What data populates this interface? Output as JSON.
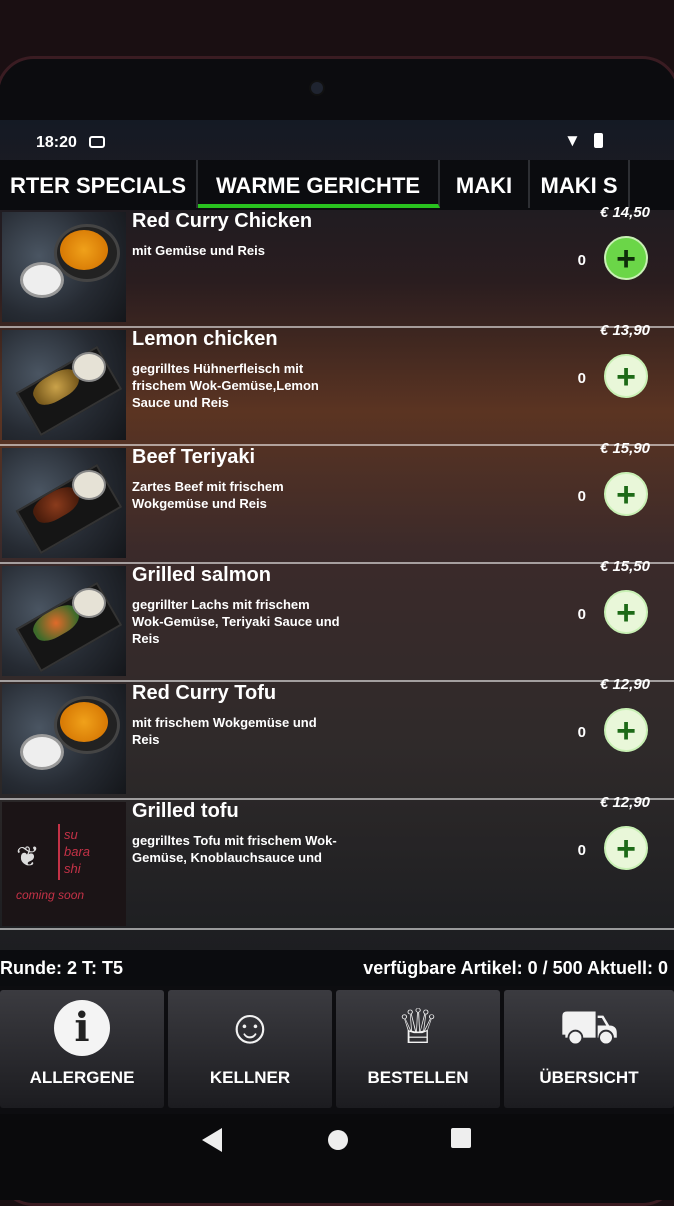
{
  "status": {
    "time": "18:20"
  },
  "tabs": [
    {
      "label": "RTER SPECIALS",
      "active": false
    },
    {
      "label": "WARME GERICHTE",
      "active": true
    },
    {
      "label": "MAKI",
      "active": false
    },
    {
      "label": "MAKI S",
      "active": false
    }
  ],
  "items": [
    {
      "name": "Red Curry Chicken",
      "desc": "mit Gemüse und Reis",
      "price": "€ 14,50",
      "qty": "0"
    },
    {
      "name": "Lemon chicken",
      "desc": "gegrilltes Hühnerfleisch mit frischem Wok-Gemüse,Lemon Sauce und Reis",
      "price": "€ 13,90",
      "qty": "0"
    },
    {
      "name": "Beef Teriyaki",
      "desc": "Zartes Beef mit frischem Wokgemüse und Reis",
      "price": "€ 15,90",
      "qty": "0"
    },
    {
      "name": "Grilled salmon",
      "desc": "gegrillter Lachs mit frischem Wok-Gemüse, Teriyaki Sauce und Reis",
      "price": "€ 15,50",
      "qty": "0"
    },
    {
      "name": "Red Curry Tofu",
      "desc": "mit frischem Wokgemüse und Reis",
      "price": "€ 12,90",
      "qty": "0"
    },
    {
      "name": "Grilled tofu",
      "desc": "gegrilltes Tofu mit frischem Wok-Gemüse, Knoblauchsauce und",
      "price": "€ 12,90",
      "qty": "0"
    }
  ],
  "logo": {
    "line1": "su",
    "line2": "bara",
    "line3": "shi",
    "sub": "coming soon"
  },
  "add_symbol": "+",
  "info_bar": {
    "round": "Runde: 2 T: T5",
    "available": "verfügbare Artikel: 0 / 500 Aktuell: 0"
  },
  "nav": [
    {
      "label": "ALLERGENE",
      "icon": "info-icon"
    },
    {
      "label": "KELLNER",
      "icon": "waiter-icon"
    },
    {
      "label": "BESTELLEN",
      "icon": "chef-hat-icon"
    },
    {
      "label": "ÜBERSICHT",
      "icon": "shopping-cart-icon"
    }
  ],
  "colors": {
    "accent_green": "#29c21f",
    "add_button_green": "#6bd648",
    "logo_red": "#c43247"
  }
}
